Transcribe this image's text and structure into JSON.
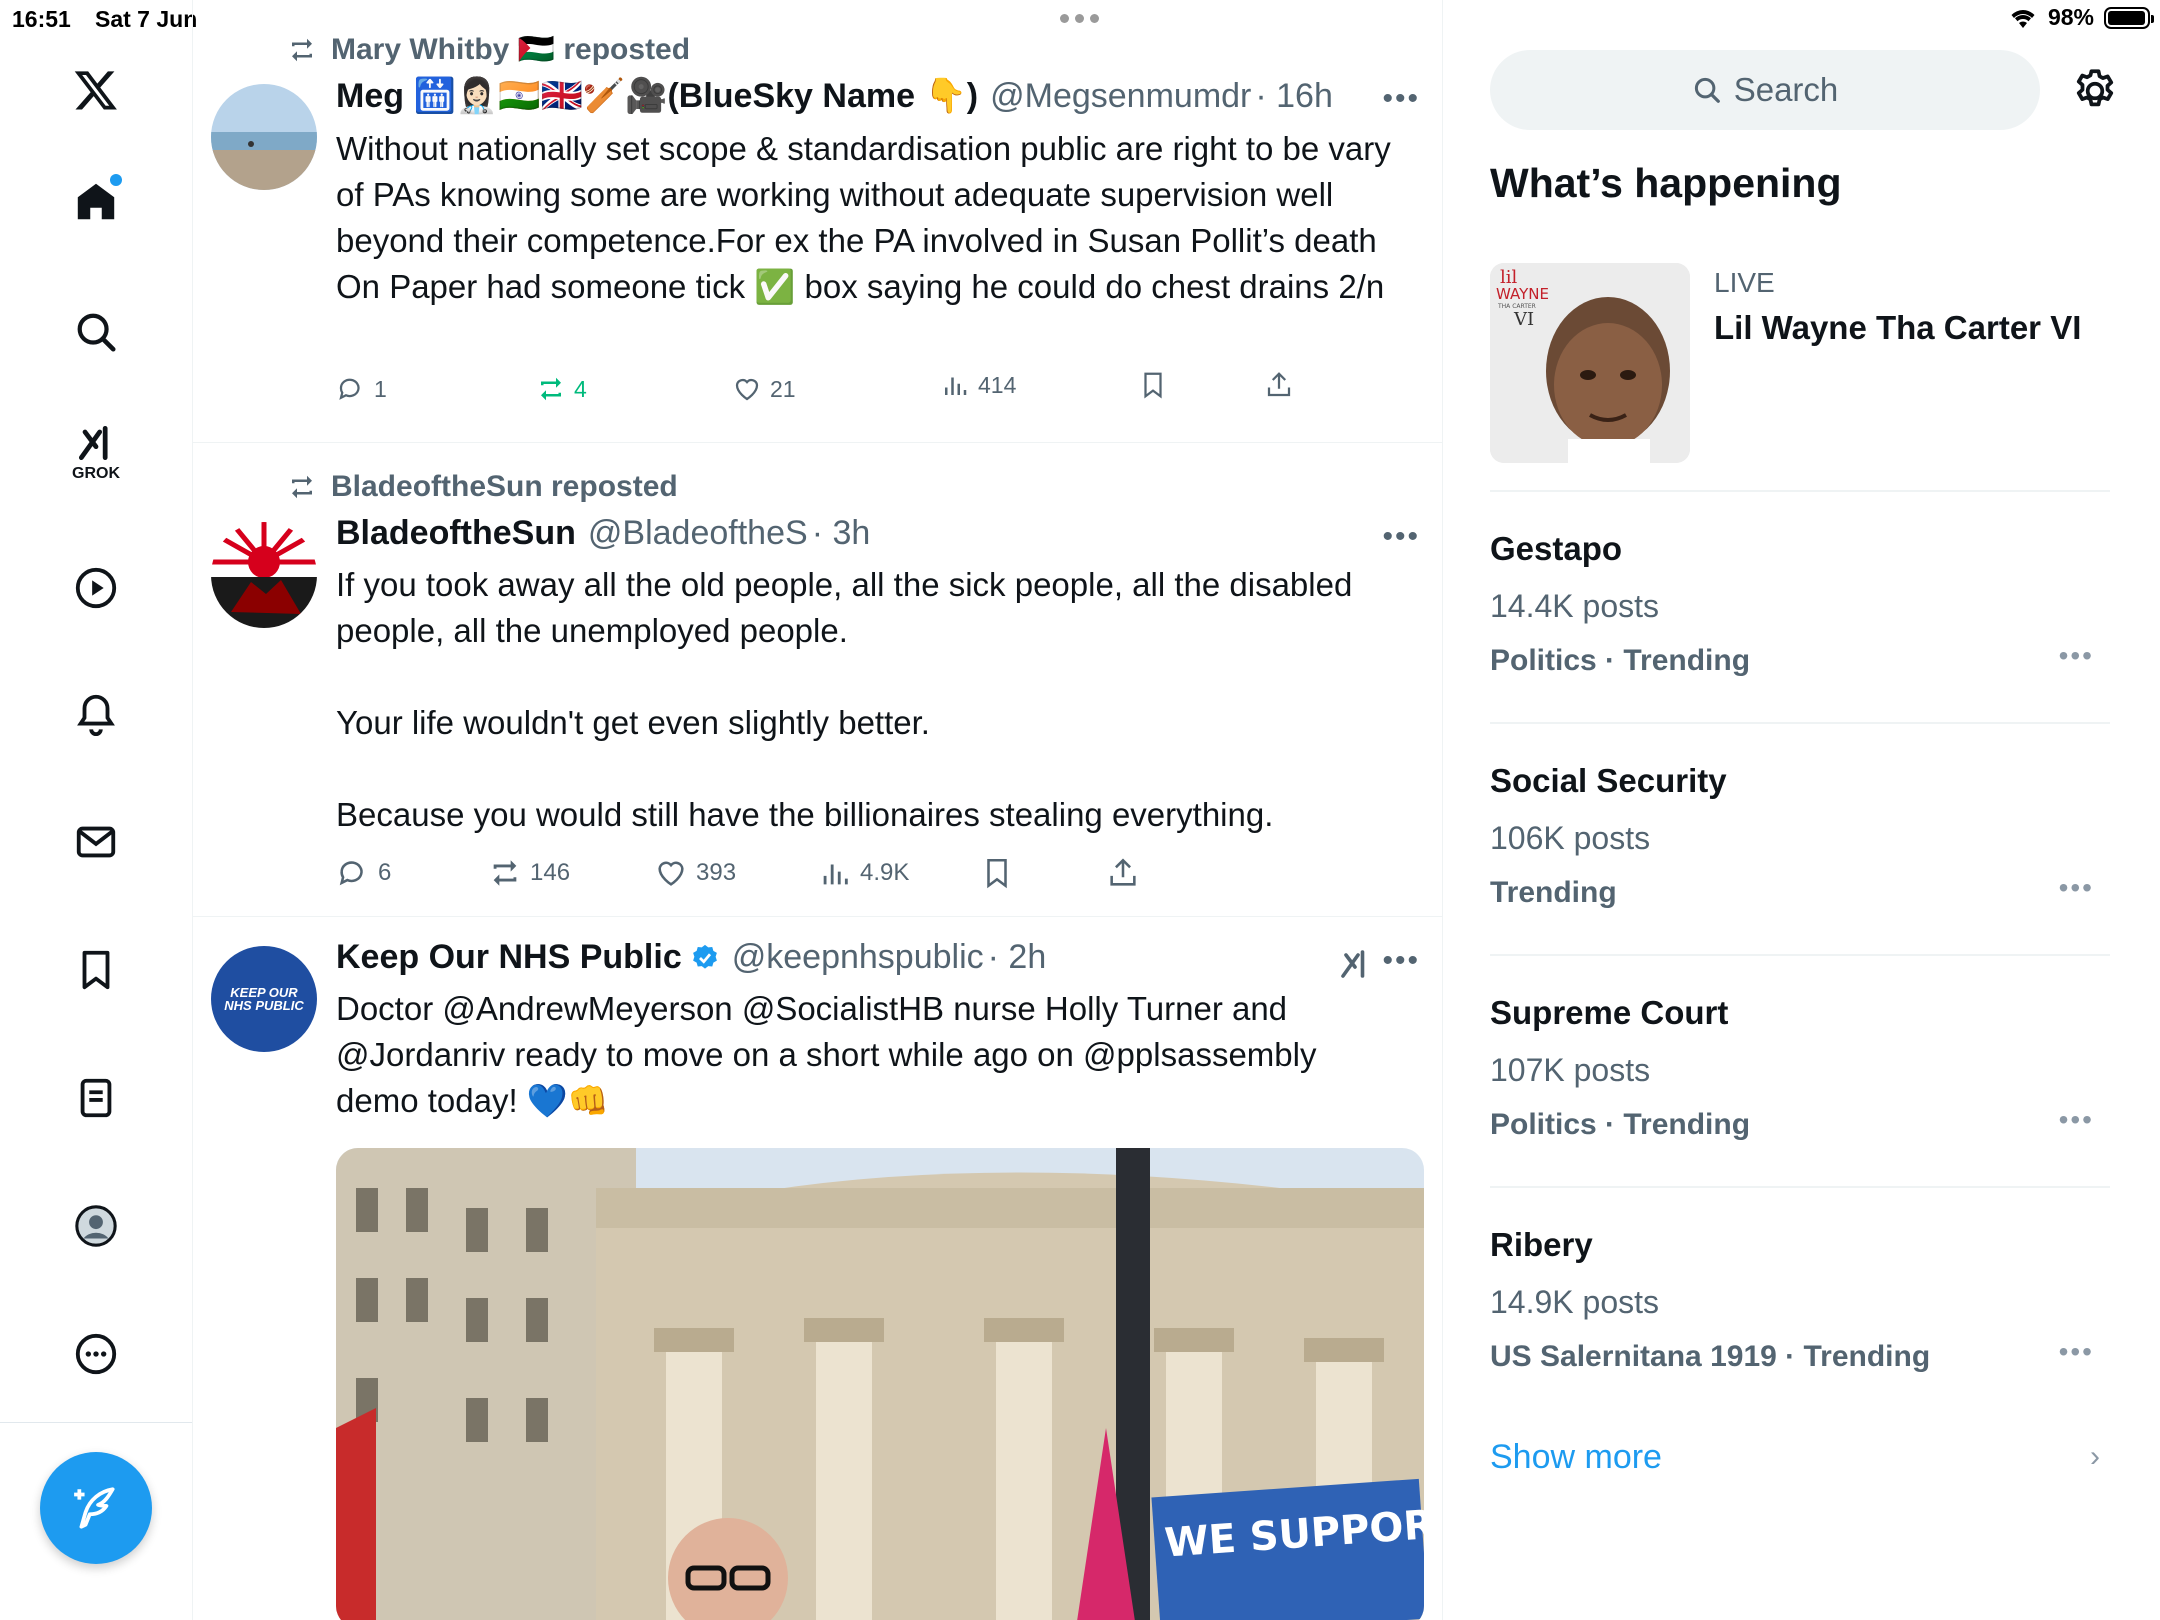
{
  "status": {
    "time": "16:51",
    "date": "Sat 7 Jun",
    "battery": "98%",
    "battery_level": 0.98
  },
  "nav": {
    "grok_label": "GROK",
    "items": [
      "home-icon",
      "search-icon",
      "grok-icon",
      "video-icon",
      "notifications-icon",
      "messages-icon",
      "bookmarks-icon",
      "lists-icon",
      "profile-icon",
      "more-icon"
    ]
  },
  "feed": {
    "posts": [
      {
        "repost_by": "Mary Whitby 🇵🇸 reposted",
        "name": "Meg 🛗👩🏻‍⚕️🇮🇳🇬🇧🏏🎥(BlueSky Name 👇)",
        "handle": "@Megsenmumdr",
        "time": "· 16h",
        "text": "Without nationally set scope & standardisation public are right to be vary of PAs knowing some are working without adequate supervision well beyond their competence.For ex the PA involved in Susan Pollit’s death\nOn Paper had someone tick ✅ box saying he could do chest drains 2/n",
        "replies": "1",
        "reposts": "4",
        "likes": "21",
        "views": "414"
      },
      {
        "repost_by": "BladeoftheSun reposted",
        "name": "BladeoftheSun",
        "handle": "@BladeoftheS",
        "time": "· 3h",
        "text": "If you took away all the old people, all the sick people, all the disabled people, all the unemployed people.\n\nYour life wouldn't get even slightly better.\n\nBecause you would still have the billionaires stealing everything.",
        "replies": "6",
        "reposts": "146",
        "likes": "393",
        "views": "4.9K"
      },
      {
        "name": "Keep Our NHS Public",
        "handle": "@keepnhspublic",
        "time": "· 2h",
        "text": "Doctor @AndrewMeyerson @SocialistHB nurse Holly Turner and @Jordanriv ready to move on a short while ago on @pplsassembly demo today! 💙👊",
        "avatar_text": "KEEP OUR NHS PUBLIC",
        "image_sign": "WE SUPPORT NHS"
      }
    ]
  },
  "sidebar": {
    "search_placeholder": "Search",
    "whats_happening": "What’s happening",
    "live": {
      "label": "LIVE",
      "title": "Lil Wayne Tha Carter VI",
      "album_text_1": "lil",
      "album_text_2": "WAYNE",
      "album_text_3": "THA CARTER",
      "album_text_4": "VI"
    },
    "trends": [
      {
        "title": "Gestapo",
        "posts": "14.4K posts",
        "category": "Politics · Trending"
      },
      {
        "title": "Social Security",
        "posts": "106K posts",
        "category": "Trending"
      },
      {
        "title": "Supreme Court",
        "posts": "107K posts",
        "category": "Politics · Trending"
      },
      {
        "title": "Ribery",
        "posts": "14.9K posts",
        "category": "US Salernitana 1919 · Trending"
      }
    ],
    "show_more": "Show more"
  }
}
